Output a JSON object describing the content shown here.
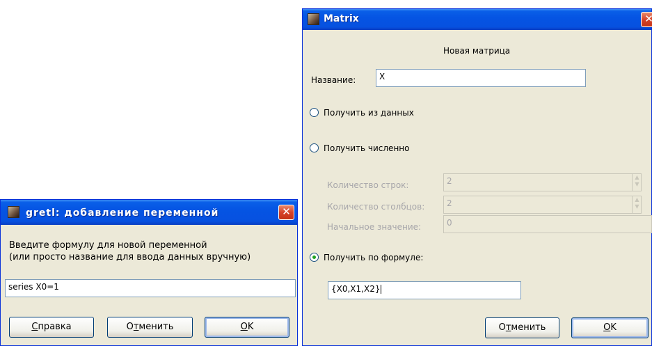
{
  "matrix_window": {
    "title": "Matrix",
    "heading": "Новая матрица",
    "name_label": "Название:",
    "name_value": "X",
    "option_from_data": "Получить из данных",
    "option_numeric": "Получить численно",
    "rows_label": "Количество строк:",
    "rows_value": "2",
    "cols_label": "Количество столбцов:",
    "cols_value": "2",
    "init_label": "Начальное значение:",
    "init_value": "0",
    "option_formula": "Получить по формуле:",
    "formula_value": "{X0,X1,X2}",
    "selected_option": "formula",
    "cancel_pre": "О",
    "cancel_mn": "т",
    "cancel_post": "менить",
    "ok_mn": "O",
    "ok_post": "K"
  },
  "add_var_window": {
    "title": "gretl: добавление переменной",
    "instruction_line1": "Введите формулу для новой переменной",
    "instruction_line2": "(или просто название для ввода данных вручную)",
    "formula_value": "series X0=1",
    "help_mn": "С",
    "help_post": "правка",
    "cancel_pre": "О",
    "cancel_mn": "т",
    "cancel_post": "менить",
    "ok_mn": "O",
    "ok_post": "K"
  },
  "icons": {
    "app": "gretl-app-icon",
    "close": "close-icon"
  }
}
